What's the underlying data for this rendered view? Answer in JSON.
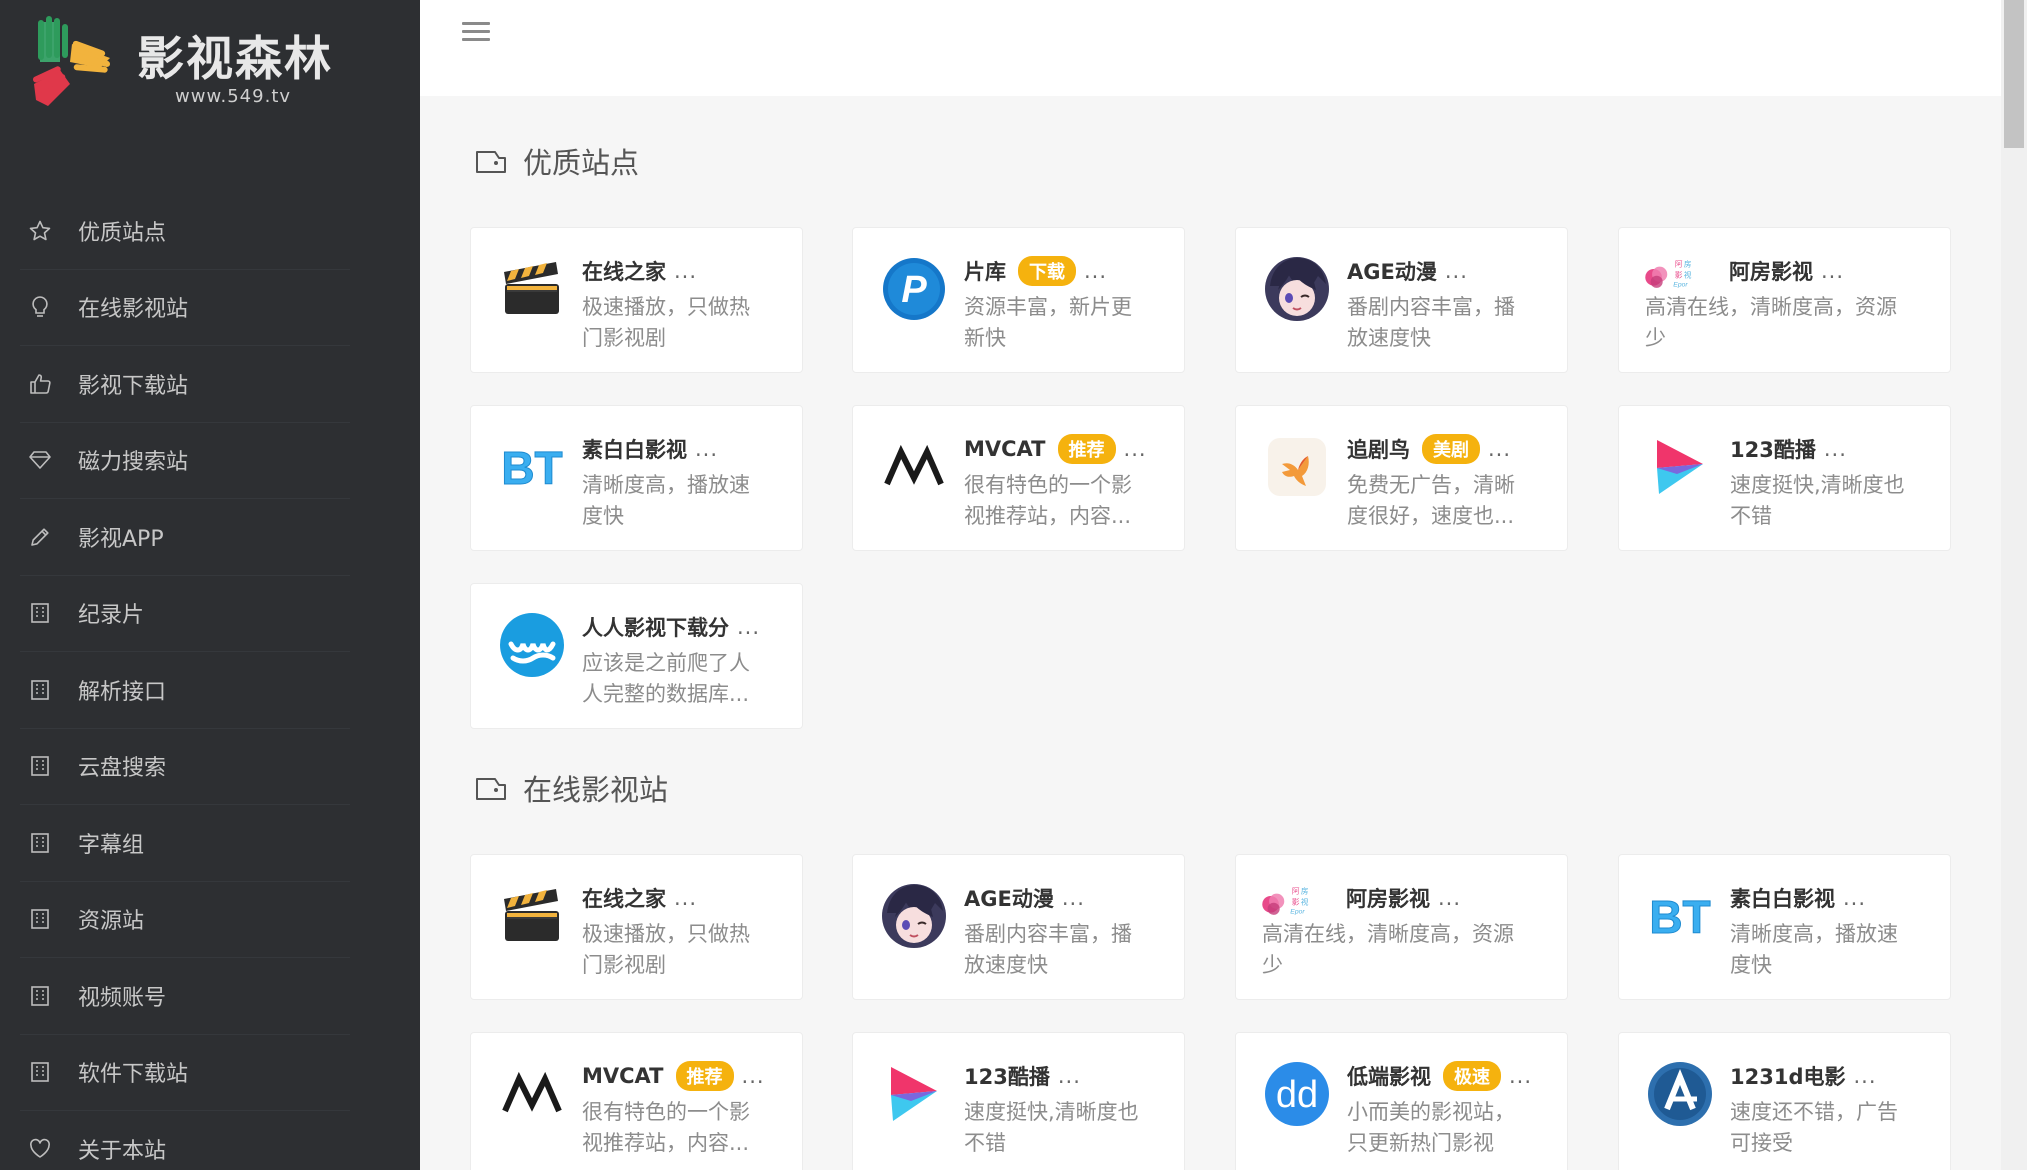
{
  "logo": {
    "name": "影视森林",
    "url": "www.549.tv"
  },
  "nav": [
    {
      "label": "优质站点",
      "icon": "star-icon"
    },
    {
      "label": "在线影视站",
      "icon": "lightbulb-icon"
    },
    {
      "label": "影视下载站",
      "icon": "thumbs-up-icon"
    },
    {
      "label": "磁力搜索站",
      "icon": "diamond-icon"
    },
    {
      "label": "影视APP",
      "icon": "pencil-icon"
    },
    {
      "label": "纪录片",
      "icon": "building-icon"
    },
    {
      "label": "解析接口",
      "icon": "building-icon"
    },
    {
      "label": "云盘搜索",
      "icon": "building-icon"
    },
    {
      "label": "字幕组",
      "icon": "building-icon"
    },
    {
      "label": "资源站",
      "icon": "building-icon"
    },
    {
      "label": "视频账号",
      "icon": "building-icon"
    },
    {
      "label": "软件下载站",
      "icon": "building-icon"
    },
    {
      "label": "关于本站",
      "icon": "heart-icon"
    }
  ],
  "sections": [
    {
      "title": "优质站点",
      "cards": [
        {
          "title": "在线之家",
          "badge": "",
          "more": "...",
          "desc": [
            "极速播放，只做热",
            "门影视剧"
          ],
          "icon": "clapperboard-icon"
        },
        {
          "title": "片库",
          "badge": "下载",
          "more": "...",
          "desc": [
            "资源丰富，新片更",
            "新快"
          ],
          "icon": "p-logo-icon"
        },
        {
          "title": "AGE动漫",
          "badge": "",
          "more": "...",
          "desc": [
            "番剧内容丰富，播",
            "放速度快"
          ],
          "icon": "anime-avatar-icon"
        },
        {
          "title": "阿房影视",
          "badge": "",
          "more": "...",
          "desc": [
            "高清在线，清晰度高，资源",
            "少"
          ],
          "icon": "afang-logo-icon"
        },
        {
          "title": "素白白影视",
          "badge": "",
          "more": "...",
          "desc": [
            "清晰度高，播放速",
            "度快"
          ],
          "icon": "bt-logo-icon"
        },
        {
          "title": "MVCAT",
          "badge": "推荐",
          "more": "...",
          "desc": [
            "很有特色的一个影",
            "视推荐站，内容..."
          ],
          "icon": "mvcat-logo-icon"
        },
        {
          "title": "追剧鸟",
          "badge": "美剧",
          "more": "...",
          "desc": [
            "免费无广告，清晰",
            "度很好，速度也..."
          ],
          "icon": "bird-logo-icon"
        },
        {
          "title": "123酷播",
          "badge": "",
          "more": "...",
          "desc": [
            "速度挺快,清晰度也",
            "不错"
          ],
          "icon": "play-logo-icon"
        },
        {
          "title": "人人影视下载分",
          "badge": "",
          "more": "...",
          "desc": [
            "应该是之前爬了人",
            "人完整的数据库..."
          ],
          "icon": "wave-logo-icon"
        }
      ]
    },
    {
      "title": "在线影视站",
      "cards": [
        {
          "title": "在线之家",
          "badge": "",
          "more": "...",
          "desc": [
            "极速播放，只做热",
            "门影视剧"
          ],
          "icon": "clapperboard-icon"
        },
        {
          "title": "AGE动漫",
          "badge": "",
          "more": "...",
          "desc": [
            "番剧内容丰富，播",
            "放速度快"
          ],
          "icon": "anime-avatar-icon"
        },
        {
          "title": "阿房影视",
          "badge": "",
          "more": "...",
          "desc": [
            "高清在线，清晰度高，资源",
            "少"
          ],
          "icon": "afang-logo-icon"
        },
        {
          "title": "素白白影视",
          "badge": "",
          "more": "...",
          "desc": [
            "清晰度高，播放速",
            "度快"
          ],
          "icon": "bt-logo-icon"
        },
        {
          "title": "MVCAT",
          "badge": "推荐",
          "more": "...",
          "desc": [
            "很有特色的一个影",
            "视推荐站，内容..."
          ],
          "icon": "mvcat-logo-icon"
        },
        {
          "title": "123酷播",
          "badge": "",
          "more": "...",
          "desc": [
            "速度挺快,清晰度也",
            "不错"
          ],
          "icon": "play-logo-icon"
        },
        {
          "title": "低端影视",
          "badge": "极速",
          "more": "...",
          "desc": [
            "小而美的影视站，",
            "只更新热门影视"
          ],
          "icon": "dd-logo-icon"
        },
        {
          "title": "1231d电影",
          "badge": "",
          "more": "...",
          "desc": [
            "速度还不错，广告",
            "可接受"
          ],
          "icon": "a-logo-icon"
        }
      ]
    }
  ]
}
